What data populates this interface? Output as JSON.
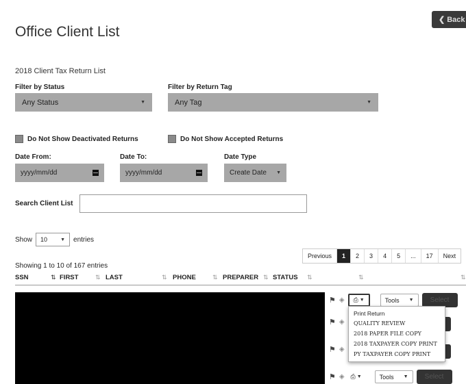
{
  "page": {
    "title": "Office Client List",
    "back_label": "Back"
  },
  "section_title": "2018 Client Tax Return List",
  "filters": {
    "status_label": "Filter by Status",
    "status_value": "Any Status",
    "tag_label": "Filter by Return Tag",
    "tag_value": "Any Tag",
    "hide_deactivated_label": "Do Not Show Deactivated Returns",
    "hide_accepted_label": "Do Not Show Accepted Returns",
    "date_from_label": "Date From:",
    "date_from_placeholder": "yyyy/mm/dd",
    "date_to_label": "Date To:",
    "date_to_placeholder": "yyyy/mm/dd",
    "date_type_label": "Date Type",
    "date_type_value": "Create Date",
    "search_label": "Search Client List",
    "search_value": ""
  },
  "entries": {
    "show_label": "Show",
    "count": "10",
    "suffix": "entries"
  },
  "pagination": {
    "previous": "Previous",
    "pages": [
      "1",
      "2",
      "3",
      "4",
      "5",
      "...",
      "17"
    ],
    "current": "1",
    "next": "Next"
  },
  "showing_text": "Showing 1 to 10 of 167 entries",
  "table": {
    "columns": [
      "SSN",
      "FIRST",
      "LAST",
      "PHONE",
      "PREPARER",
      "STATUS"
    ]
  },
  "row_actions": {
    "tools_label": "Tools",
    "select_label": "Select"
  },
  "print_menu": {
    "items": [
      "Print Return",
      "QUALITY REVIEW",
      "2018 PAPER FILE COPY",
      "2018 TAXPAYER COPY PRINT",
      "PY TAXPAYER COPY PRINT"
    ]
  },
  "icons": {
    "back": "chevron-left-icon",
    "calendar": "calendar-icon",
    "flag": "flag-icon",
    "tag": "tag-icon",
    "printer": "printer-icon"
  }
}
